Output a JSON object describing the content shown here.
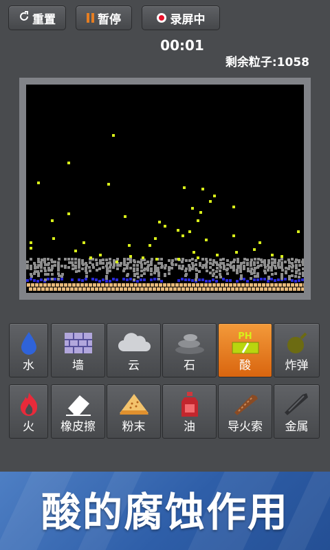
{
  "toolbar": {
    "reset_label": "重置",
    "pause_label": "暂停",
    "record_label": "录屏中"
  },
  "status": {
    "timer": "00:01",
    "remaining": "剩余粒子:1058"
  },
  "tools": [
    {
      "label": "水",
      "icon": "water-drop-icon",
      "active": false
    },
    {
      "label": "墙",
      "icon": "brick-wall-icon",
      "active": false
    },
    {
      "label": "云",
      "icon": "cloud-icon",
      "active": false
    },
    {
      "label": "石",
      "icon": "stone-stack-icon",
      "active": false
    },
    {
      "label": "酸",
      "icon": "acid-ph-icon",
      "icon_text": "PH",
      "active": true
    },
    {
      "label": "炸弹",
      "icon": "bomb-icon",
      "active": false
    },
    {
      "label": "火",
      "icon": "fire-icon",
      "active": false
    },
    {
      "label": "橡皮擦",
      "icon": "eraser-icon",
      "active": false
    },
    {
      "label": "粉末",
      "icon": "powder-icon",
      "active": false
    },
    {
      "label": "油",
      "icon": "oil-bottle-icon",
      "active": false
    },
    {
      "label": "导火索",
      "icon": "fuse-icon",
      "active": false
    },
    {
      "label": "金属",
      "icon": "metal-bar-icon",
      "active": false
    }
  ],
  "banner": {
    "text": "酸的腐蚀作用"
  },
  "colors": {
    "acid_particle": "#d8ef1a",
    "stone_particle": "#8e8e8e",
    "water_particle": "#2929d8",
    "powder_particle": "#e7b97a",
    "active_tool": "#e8822a"
  }
}
